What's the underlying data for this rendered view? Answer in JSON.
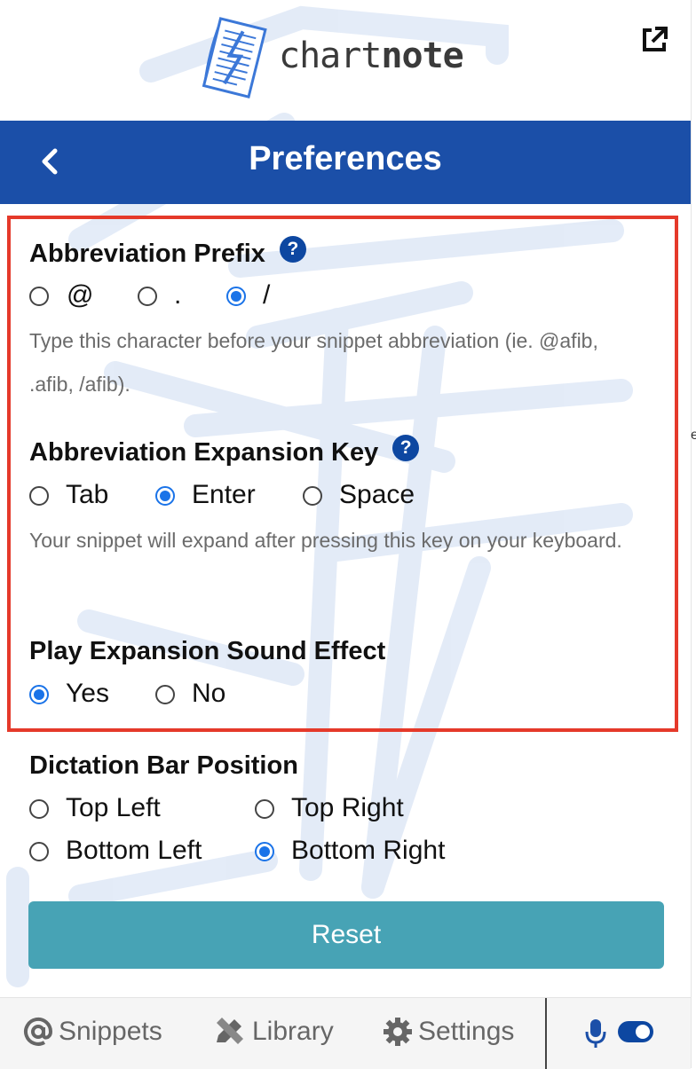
{
  "brand": {
    "name_light": "chart",
    "name_bold": "note"
  },
  "header": {
    "title": "Preferences"
  },
  "prefix": {
    "title": "Abbreviation Prefix",
    "help": "?",
    "options": [
      "@",
      ".",
      "/"
    ],
    "selected": "/",
    "description": "Type this character before your snippet abbreviation (ie. @afib, .afib, /afib)."
  },
  "expansion_key": {
    "title": "Abbreviation Expansion Key",
    "help": "?",
    "options": [
      "Tab",
      "Enter",
      "Space"
    ],
    "selected": "Enter",
    "description": "Your snippet will expand after pressing this key on your keyboard."
  },
  "sound": {
    "title": "Play Expansion Sound Effect",
    "options": [
      "Yes",
      "No"
    ],
    "selected": "Yes"
  },
  "dictation": {
    "title": "Dictation Bar Position",
    "options": [
      "Top Left",
      "Top Right",
      "Bottom Left",
      "Bottom Right"
    ],
    "selected": "Bottom Right"
  },
  "reset_label": "Reset",
  "footer": {
    "tabs": [
      "Snippets",
      "Library",
      "Settings"
    ],
    "dictation_enabled": true
  },
  "stray_char": "e",
  "colors": {
    "primary": "#1b4fa8",
    "accent": "#1a73e8",
    "reset": "#47a3b5",
    "highlight": "#e5392a"
  }
}
